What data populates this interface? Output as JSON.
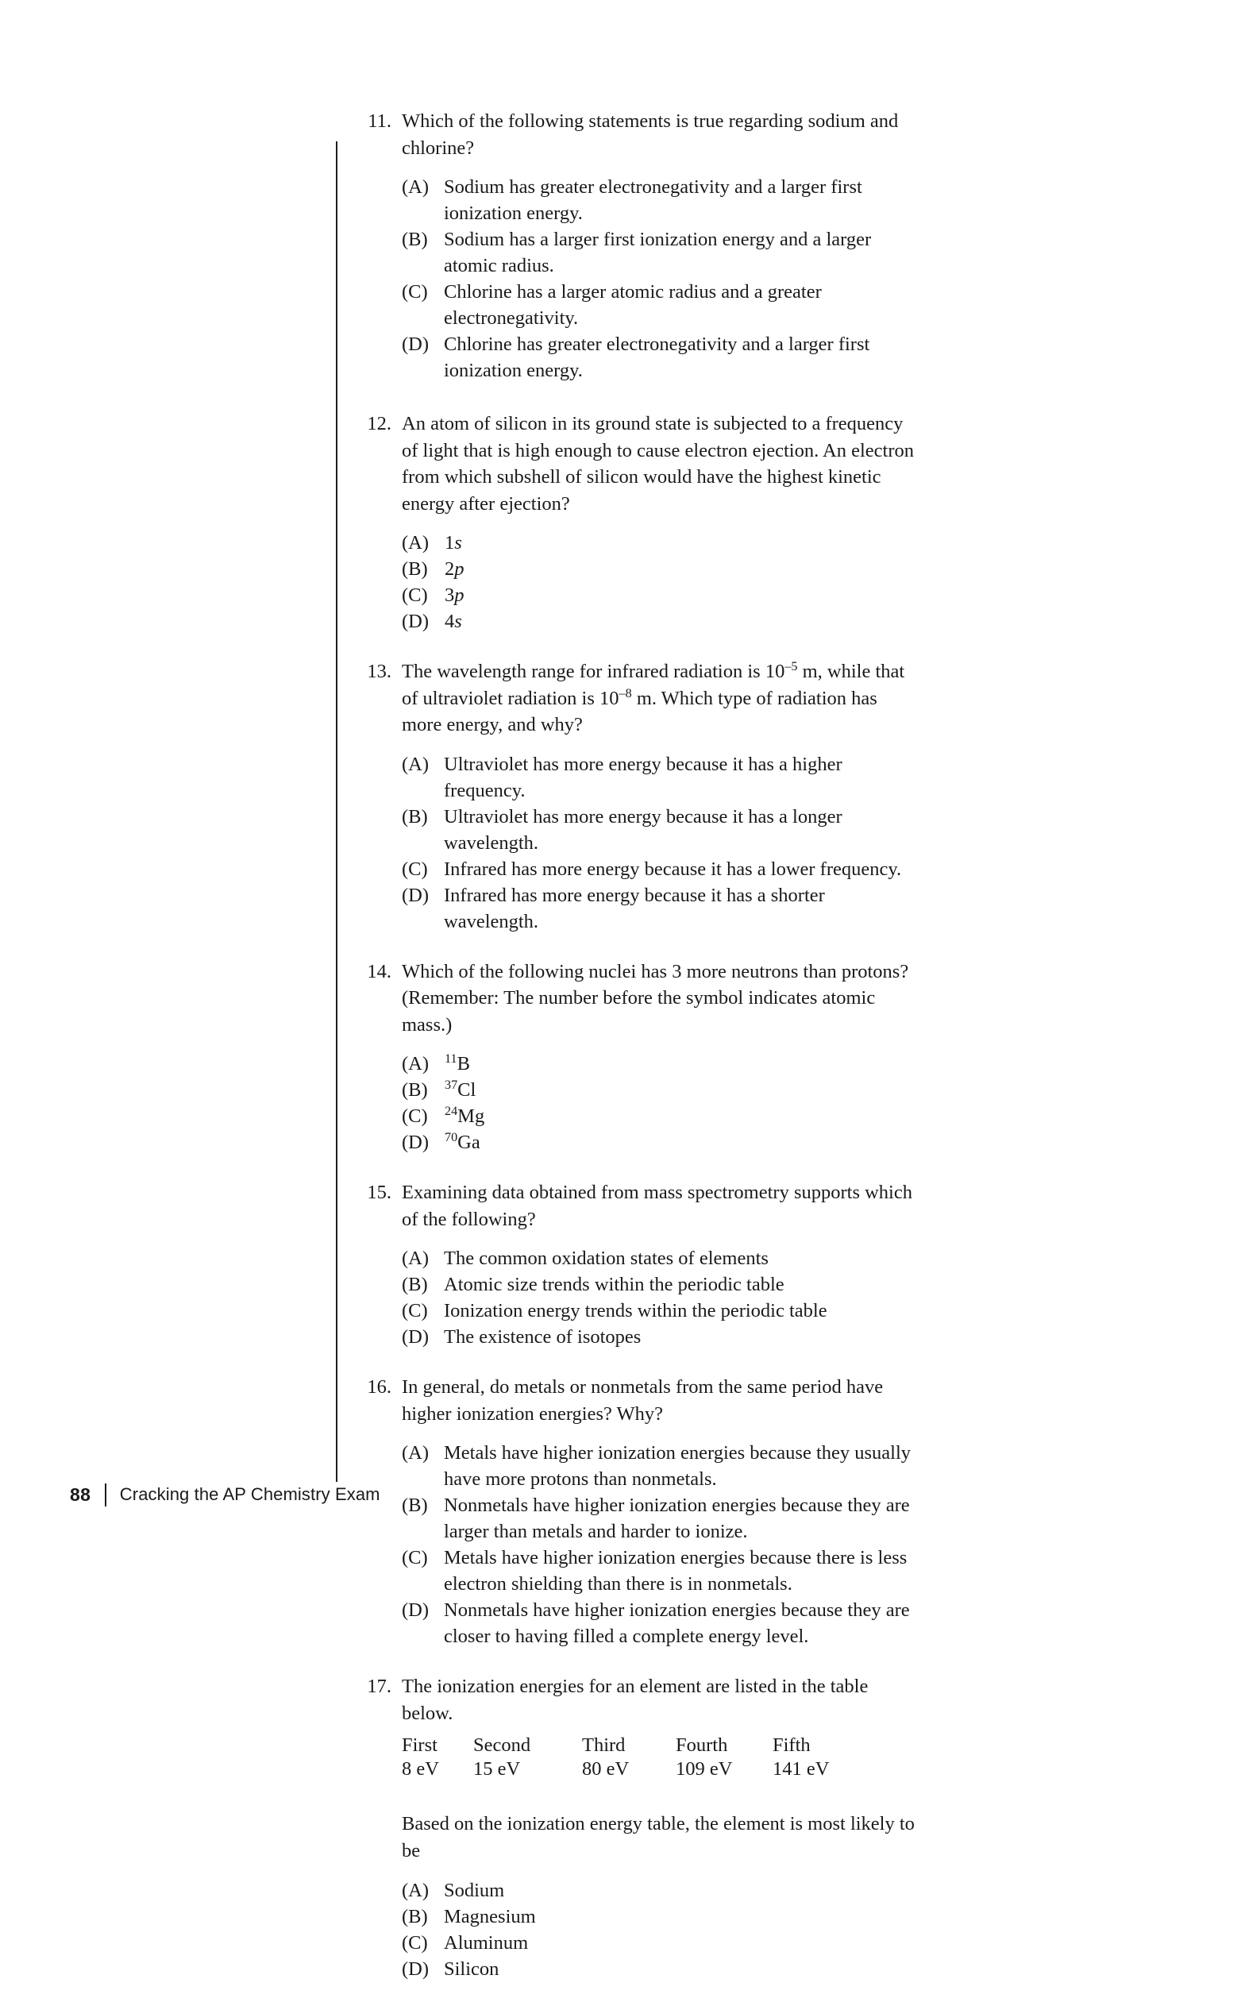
{
  "page": {
    "number": "88",
    "book_title": "Cracking the AP Chemistry Exam"
  },
  "questions": [
    {
      "number": "11.",
      "stem": "Which of the following statements is true regarding sodium and chlorine?",
      "options": [
        {
          "letter": "(A)",
          "text": "Sodium has greater electronegativity and a larger first ionization energy."
        },
        {
          "letter": "(B)",
          "text": "Sodium has a larger first ionization energy and a larger atomic radius."
        },
        {
          "letter": "(C)",
          "text": "Chlorine has a larger atomic radius and a greater electronegativity."
        },
        {
          "letter": "(D)",
          "text": "Chlorine has greater electronegativity and a larger first ionization energy."
        }
      ]
    },
    {
      "number": "12.",
      "stem": "An atom of silicon in its ground state is subjected to a frequency of light that is high enough to cause electron ejection. An electron from which subshell of silicon would have the highest kinetic energy after ejection?",
      "options": [
        {
          "letter": "(A)",
          "prefix": "1",
          "italic": "s",
          "text": "1s"
        },
        {
          "letter": "(B)",
          "prefix": "2",
          "italic": "p",
          "text": "2p"
        },
        {
          "letter": "(C)",
          "prefix": "3",
          "italic": "p",
          "text": "3p"
        },
        {
          "letter": "(D)",
          "prefix": "4",
          "italic": "s",
          "text": "4s"
        }
      ]
    },
    {
      "number": "13.",
      "stem_parts": {
        "a": "The wavelength range for infrared radiation is 10",
        "exp1": "–5",
        "b": " m, while that of ultraviolet radiation is 10",
        "exp2": "–8",
        "c": " m. Which type of radiation has more energy, and why?"
      },
      "options": [
        {
          "letter": "(A)",
          "text": "Ultraviolet has more energy because it has a higher frequency."
        },
        {
          "letter": "(B)",
          "text": "Ultraviolet has more energy because it has a longer wavelength."
        },
        {
          "letter": "(C)",
          "text": "Infrared has more energy because it has a lower frequency."
        },
        {
          "letter": "(D)",
          "text": "Infrared has more energy because it has a shorter wavelength."
        }
      ]
    },
    {
      "number": "14.",
      "stem": "Which of the following nuclei has 3 more neutrons than protons? (Remember: The number before the symbol indicates atomic mass.)",
      "options": [
        {
          "letter": "(A)",
          "mass": "11",
          "symbol": "B"
        },
        {
          "letter": "(B)",
          "mass": "37",
          "symbol": "Cl"
        },
        {
          "letter": "(C)",
          "mass": "24",
          "symbol": "Mg"
        },
        {
          "letter": "(D)",
          "mass": "70",
          "symbol": "Ga"
        }
      ]
    },
    {
      "number": "15.",
      "stem": "Examining data obtained from mass spectrometry supports which of the following?",
      "options": [
        {
          "letter": "(A)",
          "text": "The common oxidation states of elements"
        },
        {
          "letter": "(B)",
          "text": "Atomic size trends within the periodic table"
        },
        {
          "letter": "(C)",
          "text": "Ionization energy trends within the periodic table"
        },
        {
          "letter": "(D)",
          "text": "The existence of isotopes"
        }
      ]
    },
    {
      "number": "16.",
      "stem": "In general, do metals or nonmetals from the same period have higher ionization energies? Why?",
      "options": [
        {
          "letter": "(A)",
          "text": "Metals have higher ionization energies because they usually have more protons than nonmetals."
        },
        {
          "letter": "(B)",
          "text": "Nonmetals have higher ionization energies because they are larger than metals and harder to ionize."
        },
        {
          "letter": "(C)",
          "text": "Metals have higher ionization energies because there is less electron shielding than there is in nonmetals."
        },
        {
          "letter": "(D)",
          "text": "Nonmetals have higher ionization energies because they are closer to having filled a complete energy level."
        }
      ]
    },
    {
      "number": "17.",
      "stem": "The ionization energies for an element are listed in the table below.",
      "table": {
        "headers": [
          "First",
          "Second",
          "Third",
          "Fourth",
          "Fifth"
        ],
        "values": [
          "8 eV",
          "15 eV",
          "80 eV",
          "109 eV",
          "141 eV"
        ]
      },
      "followup": "Based on the ionization energy table, the element is most likely to be",
      "options": [
        {
          "letter": "(A)",
          "text": "Sodium"
        },
        {
          "letter": "(B)",
          "text": "Magnesium"
        },
        {
          "letter": "(C)",
          "text": "Aluminum"
        },
        {
          "letter": "(D)",
          "text": "Silicon"
        }
      ]
    }
  ]
}
